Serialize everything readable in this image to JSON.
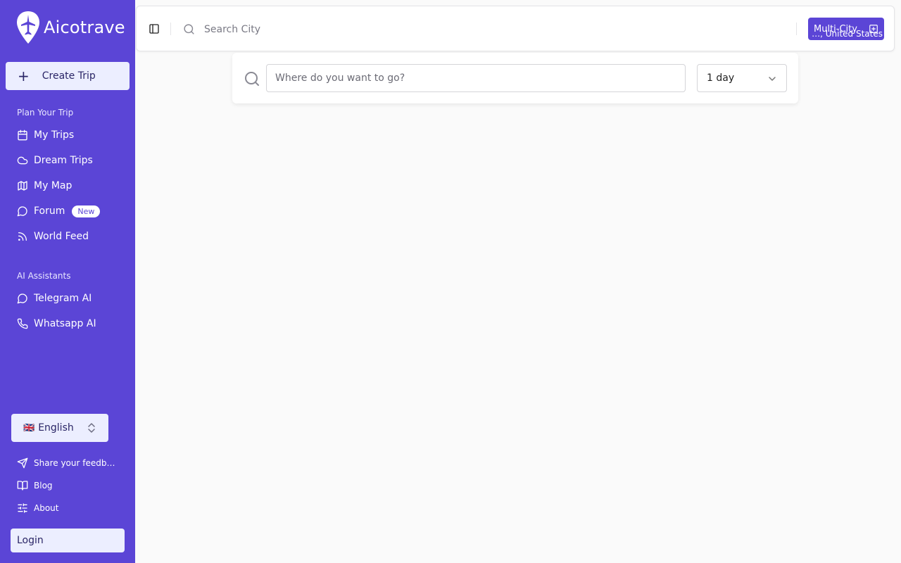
{
  "app": {
    "name": "Aicotrave"
  },
  "sidebar": {
    "create_trip": "Create Trip",
    "sections": [
      {
        "label": "Plan Your Trip"
      },
      {
        "label": "AI Assistants"
      }
    ],
    "plan_items": [
      {
        "label": "My Trips",
        "icon": "calendar-icon"
      },
      {
        "label": "Dream Trips",
        "icon": "cloud-icon"
      },
      {
        "label": "My Map",
        "icon": "map-icon"
      },
      {
        "label": "Forum",
        "icon": "message-circle-icon",
        "badge": "New"
      },
      {
        "label": "World Feed",
        "icon": "rss-icon"
      }
    ],
    "ai_items": [
      {
        "label": "Telegram AI",
        "icon": "message-circle-icon"
      },
      {
        "label": "Whatsapp AI",
        "icon": "phone-icon"
      }
    ],
    "language": {
      "flag": "🇬🇧",
      "value": "English"
    },
    "footer_items": [
      {
        "label": "Share your feedb…",
        "icon": "send-icon"
      },
      {
        "label": "Blog",
        "icon": "book-open-icon"
      },
      {
        "label": "About",
        "icon": "sliders-icon"
      }
    ],
    "login": "Login"
  },
  "topbar": {
    "search_placeholder": "Search City",
    "location": "…, United States",
    "multi_city": "Multi-City"
  },
  "search_panel": {
    "destination_placeholder": "Where do you want to go?",
    "duration": "1 day"
  },
  "colors": {
    "accent": "#5b45d6",
    "button_bg": "#eceeff",
    "page_bg": "#fafafa"
  }
}
